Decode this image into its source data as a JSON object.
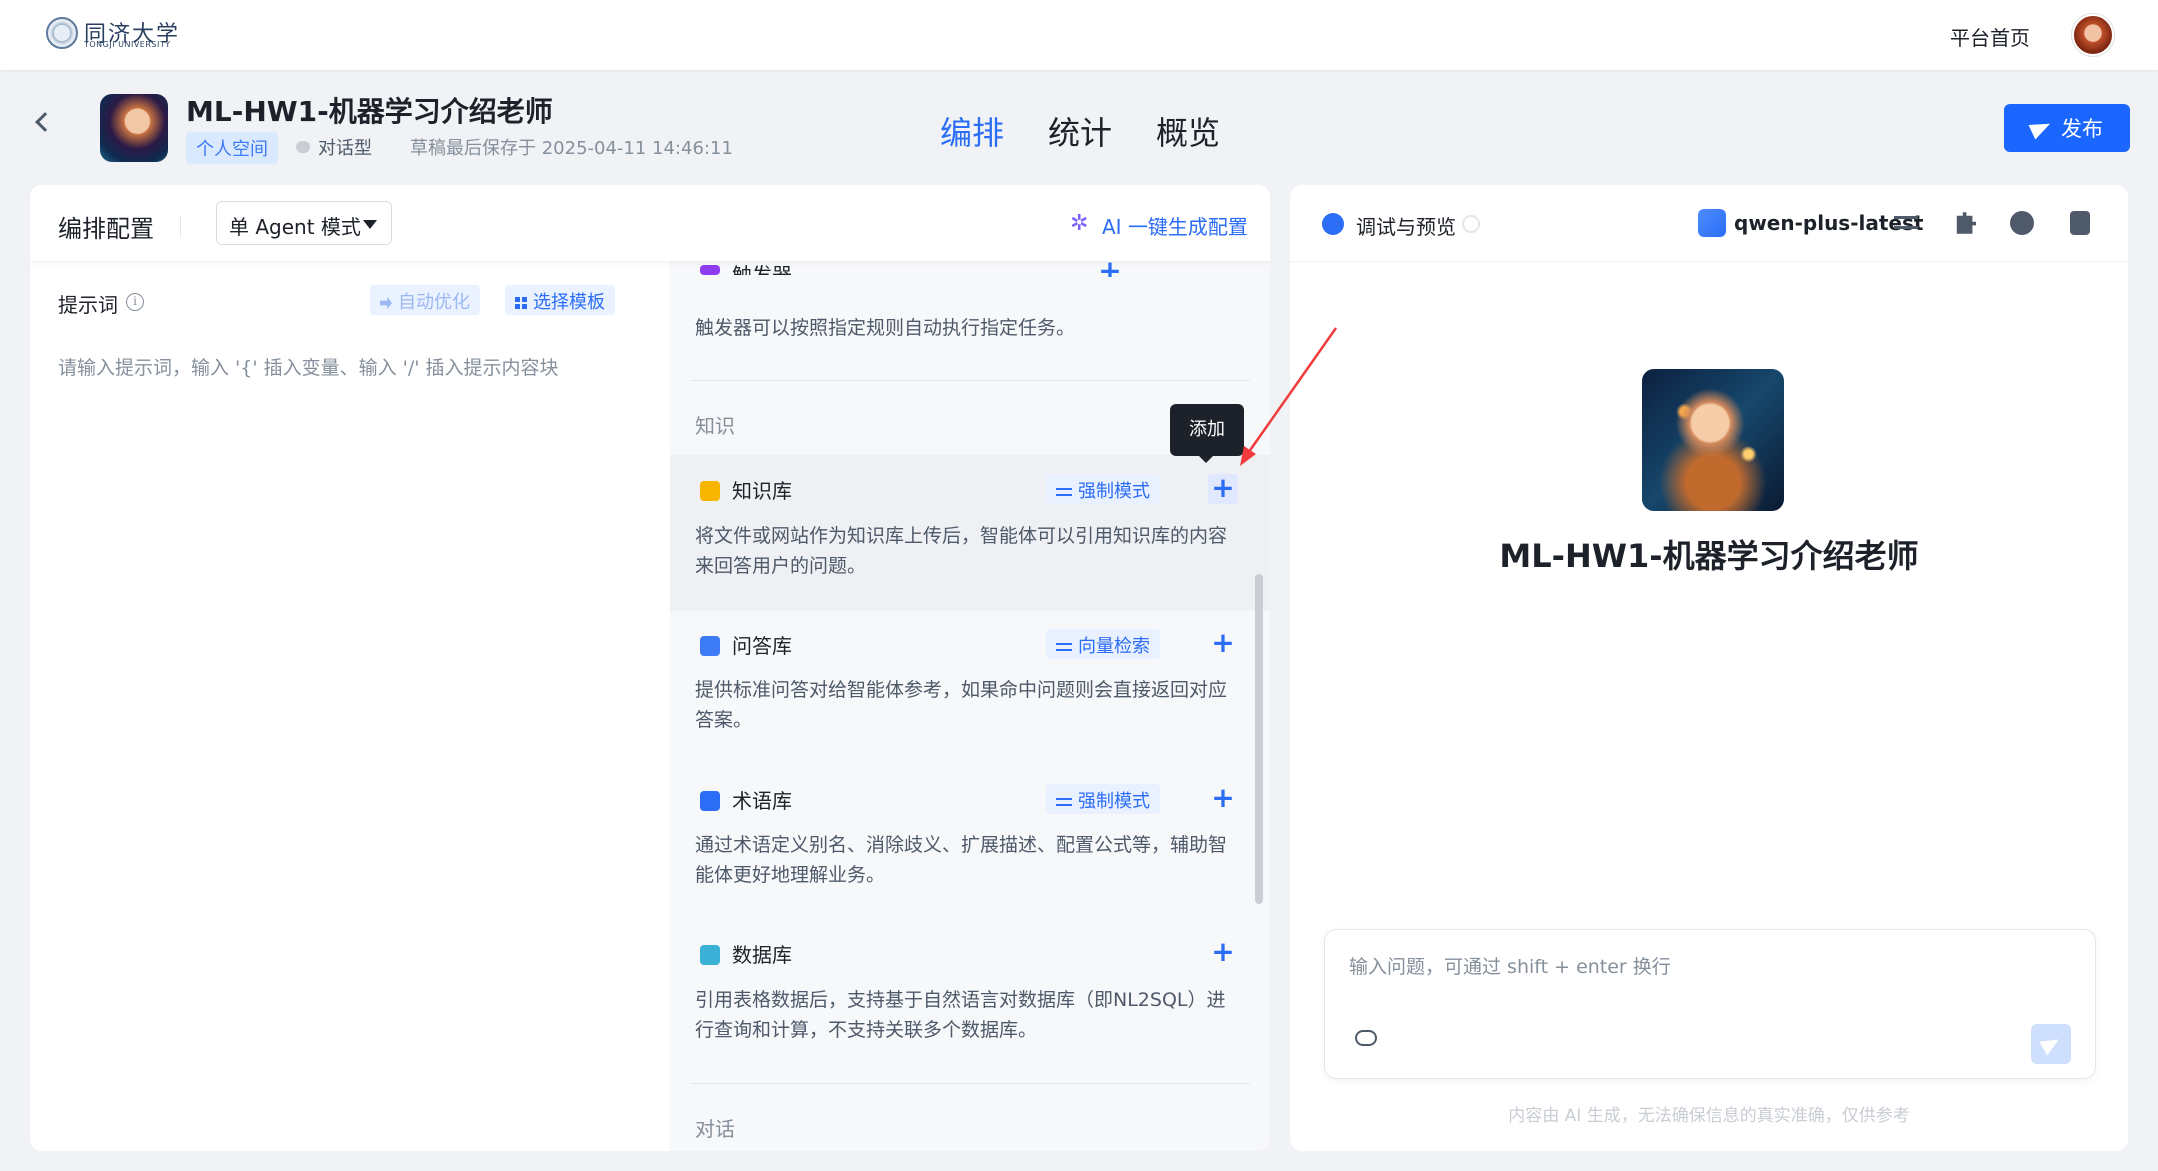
{
  "topbar": {
    "logo_cn": "同济大学",
    "logo_en": "TONGJI UNIVERSITY",
    "platform_home": "平台首页"
  },
  "header": {
    "agent_name": "ML-HW1-机器学习介绍老师",
    "space_tag": "个人空间",
    "type_tag": "对话型",
    "draft_saved": "草稿最后保存于 2025-04-11 14:46:11",
    "tabs": [
      {
        "label": "编排",
        "active": true
      },
      {
        "label": "统计",
        "active": false
      },
      {
        "label": "概览",
        "active": false
      }
    ],
    "publish_label": "发布"
  },
  "config": {
    "title": "编排配置",
    "mode_value": "单 Agent 模式",
    "ai_generate": "AI 一键生成配置",
    "prompt_label": "提示词",
    "auto_optimize": "自动优化",
    "choose_template": "选择模板",
    "prompt_placeholder": "请输入提示词，输入 '{' 插入变量、输入 '/' 插入提示内容块"
  },
  "skills": {
    "trigger": {
      "name": "触发器",
      "desc": "触发器可以按照指定规则自动执行指定任务。"
    },
    "knowledge_section": "知识",
    "items": [
      {
        "name": "知识库",
        "mode": "强制模式",
        "desc": "将文件或网站作为知识库上传后，智能体可以引用知识库的内容来回答用户的问题。",
        "icon_color": "#f7b500"
      },
      {
        "name": "问答库",
        "mode": "向量检索",
        "desc": "提供标准问答对给智能体参考，如果命中问题则会直接返回对应答案。",
        "icon_color": "#3c7bf4"
      },
      {
        "name": "术语库",
        "mode": "强制模式",
        "desc": "通过术语定义别名、消除歧义、扩展描述、配置公式等，辅助智能体更好地理解业务。",
        "icon_color": "#2b6df5"
      },
      {
        "name": "数据库",
        "mode": "",
        "desc": "引用表格数据后，支持基于自然语言对数据库（即NL2SQL）进行查询和计算，不支持关联多个数据库。",
        "icon_color": "#3ab0d6"
      }
    ],
    "dialog_section": "对话",
    "tooltip": "添加"
  },
  "preview": {
    "title": "调试与预览",
    "model": "qwen-plus-latest",
    "agent_name": "ML-HW1-机器学习介绍老师",
    "chat_placeholder": "输入问题，可通过 shift + enter 换行",
    "disclaimer": "内容由 AI 生成，无法确保信息的真实准确，仅供参考"
  },
  "colors": {
    "accent": "#2b6df5",
    "publish_bg": "#1a66ff",
    "annotation_arrow": "#ef3b3b"
  }
}
